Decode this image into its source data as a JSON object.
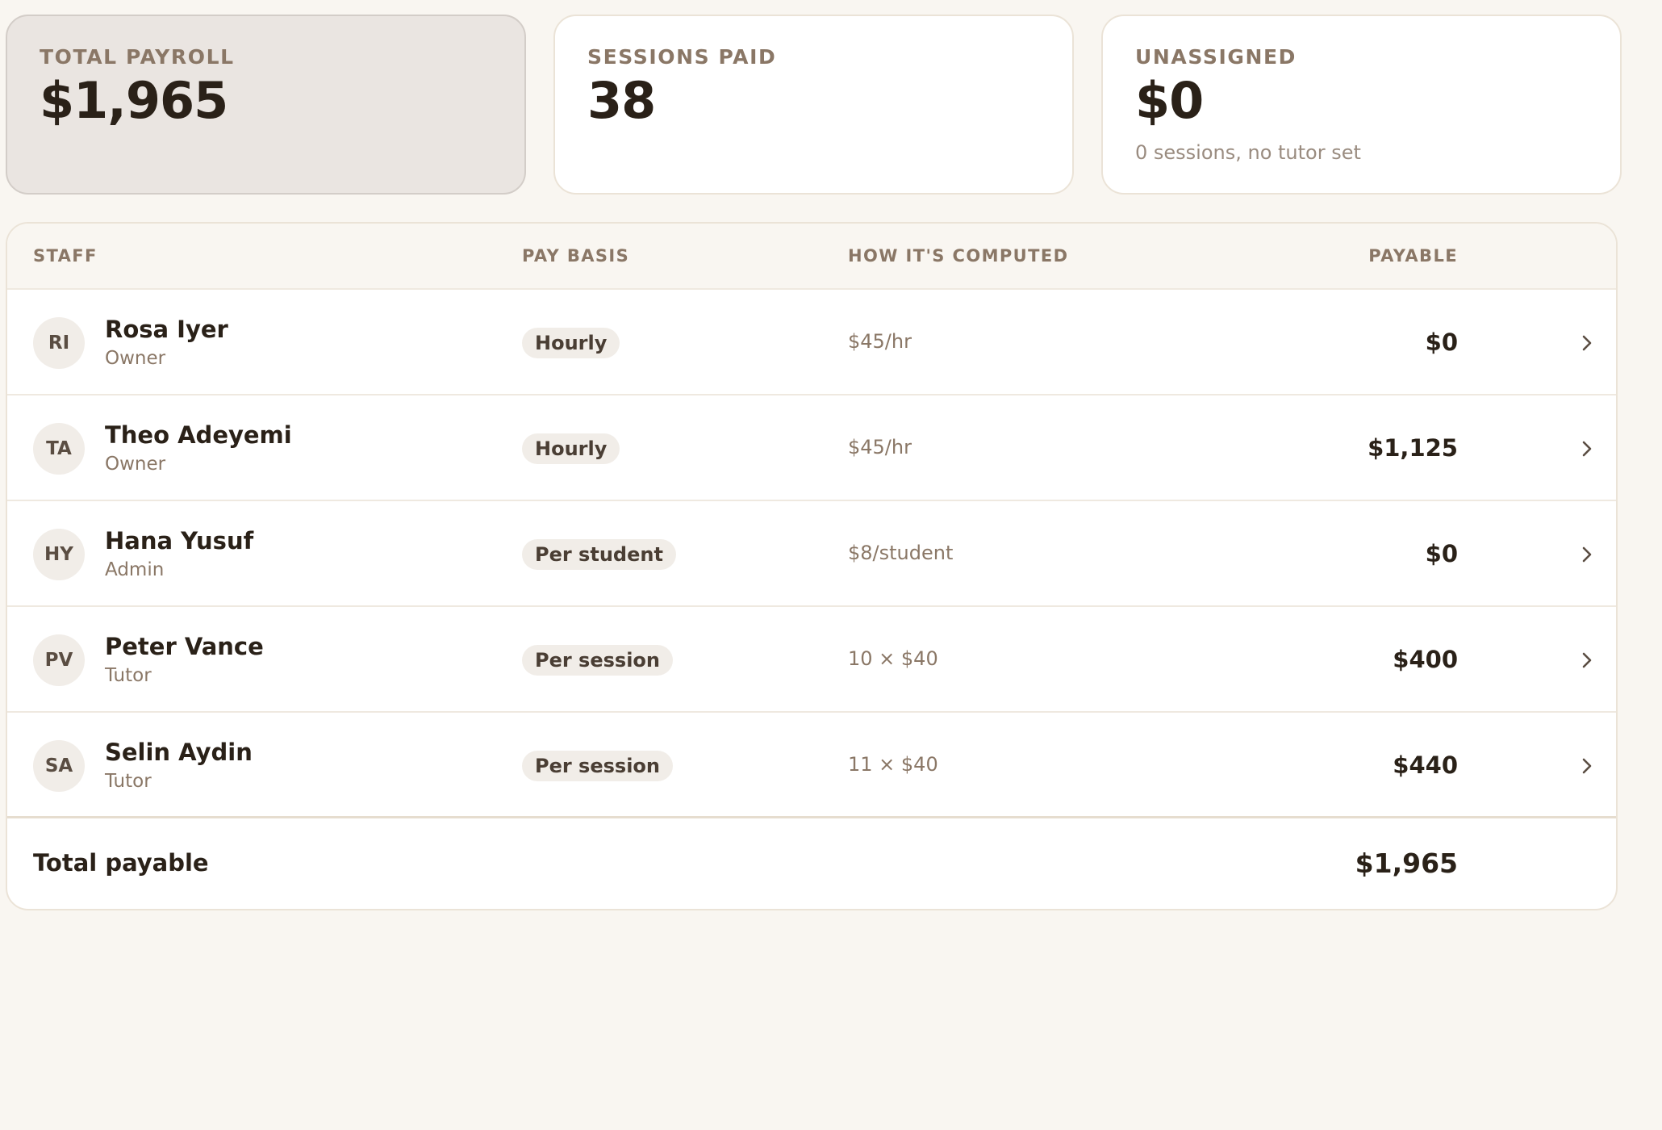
{
  "stats": [
    {
      "label": "TOTAL PAYROLL",
      "value": "$1,965",
      "sub": ""
    },
    {
      "label": "SESSIONS PAID",
      "value": "38",
      "sub": ""
    },
    {
      "label": "UNASSIGNED",
      "value": "$0",
      "sub": "0 sessions, no tutor set"
    }
  ],
  "table": {
    "headers": {
      "staff": "STAFF",
      "pay_basis": "PAY BASIS",
      "computed": "HOW IT'S COMPUTED",
      "payable": "PAYABLE"
    },
    "rows": [
      {
        "initials": "RI",
        "name": "Rosa Iyer",
        "role": "Owner",
        "basis": "Hourly",
        "computed": "$45/hr",
        "payable": "$0"
      },
      {
        "initials": "TA",
        "name": "Theo Adeyemi",
        "role": "Owner",
        "basis": "Hourly",
        "computed": "$45/hr",
        "payable": "$1,125"
      },
      {
        "initials": "HY",
        "name": "Hana Yusuf",
        "role": "Admin",
        "basis": "Per student",
        "computed": "$8/student",
        "payable": "$0"
      },
      {
        "initials": "PV",
        "name": "Peter Vance",
        "role": "Tutor",
        "basis": "Per session",
        "computed": "10 × $40",
        "payable": "$400"
      },
      {
        "initials": "SA",
        "name": "Selin Aydin",
        "role": "Tutor",
        "basis": "Per session",
        "computed": "11 × $40",
        "payable": "$440"
      }
    ],
    "footer": {
      "label": "Total payable",
      "value": "$1,965"
    }
  },
  "colors": {
    "background": "#f9f6f1",
    "card_border": "#ebe3d7",
    "active_card": "#eae5e1",
    "text_primary": "#2a2118",
    "text_muted": "#8a7766",
    "pill_bg": "#f1ede8"
  },
  "icons": {
    "row_action": "chevron-right-icon"
  }
}
